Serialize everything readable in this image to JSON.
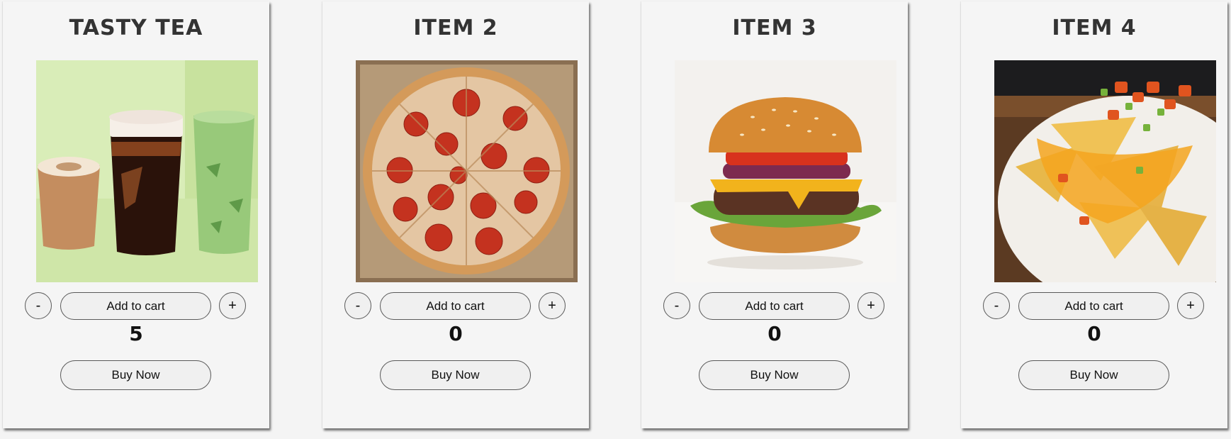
{
  "products": [
    {
      "title": "TASTY TEA",
      "image_subject": "coffee-and-tea-drinks",
      "quantity": "5",
      "minus_label": "-",
      "plus_label": "+",
      "add_to_cart_label": "Add to cart",
      "buy_now_label": "Buy Now"
    },
    {
      "title": "ITEM 2",
      "image_subject": "pepperoni-pizza",
      "quantity": "0",
      "minus_label": "-",
      "plus_label": "+",
      "add_to_cart_label": "Add to cart",
      "buy_now_label": "Buy Now"
    },
    {
      "title": "ITEM 3",
      "image_subject": "cheeseburger",
      "quantity": "0",
      "minus_label": "-",
      "plus_label": "+",
      "add_to_cart_label": "Add to cart",
      "buy_now_label": "Buy Now"
    },
    {
      "title": "ITEM 4",
      "image_subject": "loaded-nachos",
      "quantity": "0",
      "minus_label": "-",
      "plus_label": "+",
      "add_to_cart_label": "Add to cart",
      "buy_now_label": "Buy Now"
    }
  ],
  "colors": {
    "page_background": "#f4f4f4",
    "card_background": "#f5f5f5",
    "button_background": "#f0f0f0",
    "button_border": "#5a5a5a",
    "title_text": "#333333"
  }
}
